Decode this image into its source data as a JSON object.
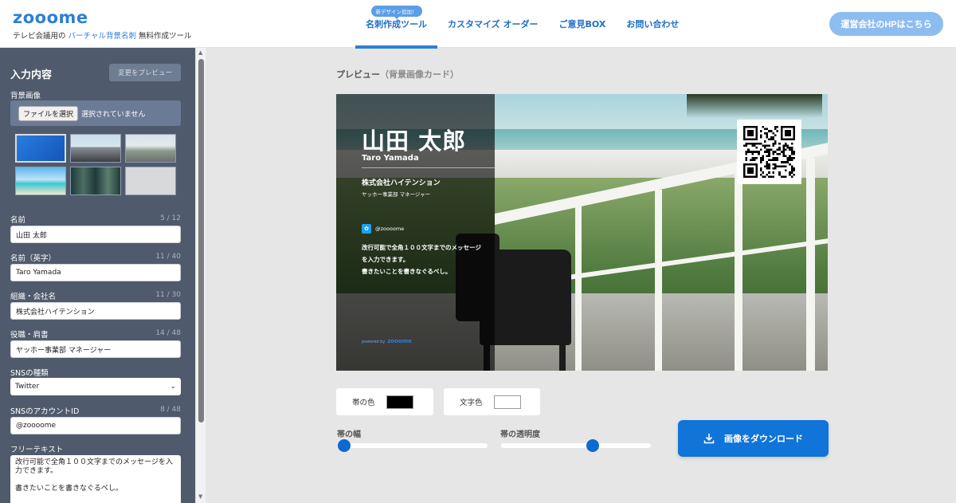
{
  "header": {
    "logo": "zooome",
    "tagline_pre": "テレビ会議用の",
    "tagline_highlight": "バーチャル背景名刺",
    "tagline_post": "無料作成ツール",
    "nav": [
      {
        "label": "名刺作成ツール",
        "badge": "新デザイン追加！",
        "active": true
      },
      {
        "label": "カスタマイズ オーダー"
      },
      {
        "label": "ご意見BOX"
      },
      {
        "label": "お問い合わせ"
      }
    ],
    "hp_button": "運営会社のHPはこちら"
  },
  "sidebar": {
    "title": "入力内容",
    "preview_button": "変更をプレビュー",
    "background_label": "背景画像",
    "file_button": "ファイルを選択",
    "file_status": "選択されていません",
    "fields": {
      "name": {
        "label": "名前",
        "count": "5 / 12",
        "value": "山田 太郎"
      },
      "name_en": {
        "label": "名前（英字）",
        "count": "11 / 40",
        "value": "Taro Yamada"
      },
      "org": {
        "label": "組織・会社名",
        "count": "11 / 30",
        "value": "株式会社ハイテンション"
      },
      "position": {
        "label": "役職・肩書",
        "count": "14 / 48",
        "value": "ヤッホー事業部 マネージャー"
      },
      "sns_type": {
        "label": "SNSの種類",
        "value": "Twitter"
      },
      "sns_id": {
        "label": "SNSのアカウントID",
        "count": "8 / 48",
        "value": "@zoooome"
      },
      "free_text": {
        "label": "フリーテキスト",
        "value": "改行可能で全角１００文字までのメッセージを入力できます。\n\n書きたいことを書きなぐるべし。"
      }
    }
  },
  "main": {
    "title": "プレビュー",
    "title_sub": "（背景画像カード）",
    "card": {
      "name": "山田 太郎",
      "name_en": "Taro Yamada",
      "org": "株式会社ハイテンション",
      "position": "ヤッホー事業部 マネージャー",
      "sns": "@zoooome",
      "message_lines": [
        "改行可能で全角１００文字までのメッセージ",
        "を入力できます。",
        "書きたいことを書きなぐるべし。"
      ],
      "powered_by": "powered by",
      "powered_brand": "zooome"
    },
    "band_color_label": "帯の色",
    "text_color_label": "文字色",
    "band_color": "#000000",
    "text_color": "#ffffff",
    "band_width_label": "帯の幅",
    "band_opacity_label": "帯の透明度",
    "band_width_value": 0.0,
    "band_opacity_value": 0.62,
    "download_button": "画像をダウンロード"
  },
  "colors": {
    "brand": "#2f7fd6",
    "sidebar": "#4f5b6d",
    "download": "#1074d8"
  }
}
